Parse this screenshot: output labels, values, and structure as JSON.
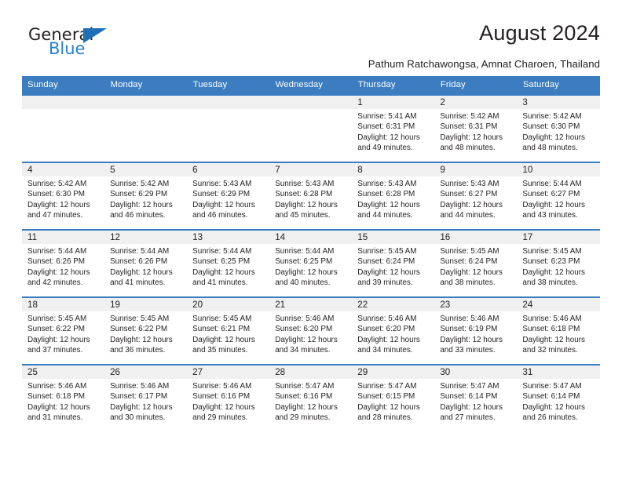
{
  "brand": {
    "name_top": "General",
    "name_bottom": "Blue",
    "accent_color": "#2980d0",
    "triangle_color": "#1e6fb8"
  },
  "header": {
    "title": "August 2024",
    "subtitle": "Pathum Ratchawongsa, Amnat Charoen, Thailand",
    "header_bg": "#3b7dc0",
    "header_text": "#ffffff"
  },
  "weekdays": [
    "Sunday",
    "Monday",
    "Tuesday",
    "Wednesday",
    "Thursday",
    "Friday",
    "Saturday"
  ],
  "labels": {
    "sunrise_prefix": "Sunrise:",
    "sunset_prefix": "Sunset:",
    "daylight_prefix": "Daylight:"
  },
  "weeks": [
    [
      {
        "day": "",
        "empty": true
      },
      {
        "day": "",
        "empty": true
      },
      {
        "day": "",
        "empty": true
      },
      {
        "day": "",
        "empty": true
      },
      {
        "day": "1",
        "sunrise": "Sunrise: 5:41 AM",
        "sunset": "Sunset: 6:31 PM",
        "daylight": "Daylight: 12 hours and 49 minutes."
      },
      {
        "day": "2",
        "sunrise": "Sunrise: 5:42 AM",
        "sunset": "Sunset: 6:31 PM",
        "daylight": "Daylight: 12 hours and 48 minutes."
      },
      {
        "day": "3",
        "sunrise": "Sunrise: 5:42 AM",
        "sunset": "Sunset: 6:30 PM",
        "daylight": "Daylight: 12 hours and 48 minutes."
      }
    ],
    [
      {
        "day": "4",
        "sunrise": "Sunrise: 5:42 AM",
        "sunset": "Sunset: 6:30 PM",
        "daylight": "Daylight: 12 hours and 47 minutes."
      },
      {
        "day": "5",
        "sunrise": "Sunrise: 5:42 AM",
        "sunset": "Sunset: 6:29 PM",
        "daylight": "Daylight: 12 hours and 46 minutes."
      },
      {
        "day": "6",
        "sunrise": "Sunrise: 5:43 AM",
        "sunset": "Sunset: 6:29 PM",
        "daylight": "Daylight: 12 hours and 46 minutes."
      },
      {
        "day": "7",
        "sunrise": "Sunrise: 5:43 AM",
        "sunset": "Sunset: 6:28 PM",
        "daylight": "Daylight: 12 hours and 45 minutes."
      },
      {
        "day": "8",
        "sunrise": "Sunrise: 5:43 AM",
        "sunset": "Sunset: 6:28 PM",
        "daylight": "Daylight: 12 hours and 44 minutes."
      },
      {
        "day": "9",
        "sunrise": "Sunrise: 5:43 AM",
        "sunset": "Sunset: 6:27 PM",
        "daylight": "Daylight: 12 hours and 44 minutes."
      },
      {
        "day": "10",
        "sunrise": "Sunrise: 5:44 AM",
        "sunset": "Sunset: 6:27 PM",
        "daylight": "Daylight: 12 hours and 43 minutes."
      }
    ],
    [
      {
        "day": "11",
        "sunrise": "Sunrise: 5:44 AM",
        "sunset": "Sunset: 6:26 PM",
        "daylight": "Daylight: 12 hours and 42 minutes."
      },
      {
        "day": "12",
        "sunrise": "Sunrise: 5:44 AM",
        "sunset": "Sunset: 6:26 PM",
        "daylight": "Daylight: 12 hours and 41 minutes."
      },
      {
        "day": "13",
        "sunrise": "Sunrise: 5:44 AM",
        "sunset": "Sunset: 6:25 PM",
        "daylight": "Daylight: 12 hours and 41 minutes."
      },
      {
        "day": "14",
        "sunrise": "Sunrise: 5:44 AM",
        "sunset": "Sunset: 6:25 PM",
        "daylight": "Daylight: 12 hours and 40 minutes."
      },
      {
        "day": "15",
        "sunrise": "Sunrise: 5:45 AM",
        "sunset": "Sunset: 6:24 PM",
        "daylight": "Daylight: 12 hours and 39 minutes."
      },
      {
        "day": "16",
        "sunrise": "Sunrise: 5:45 AM",
        "sunset": "Sunset: 6:24 PM",
        "daylight": "Daylight: 12 hours and 38 minutes."
      },
      {
        "day": "17",
        "sunrise": "Sunrise: 5:45 AM",
        "sunset": "Sunset: 6:23 PM",
        "daylight": "Daylight: 12 hours and 38 minutes."
      }
    ],
    [
      {
        "day": "18",
        "sunrise": "Sunrise: 5:45 AM",
        "sunset": "Sunset: 6:22 PM",
        "daylight": "Daylight: 12 hours and 37 minutes."
      },
      {
        "day": "19",
        "sunrise": "Sunrise: 5:45 AM",
        "sunset": "Sunset: 6:22 PM",
        "daylight": "Daylight: 12 hours and 36 minutes."
      },
      {
        "day": "20",
        "sunrise": "Sunrise: 5:45 AM",
        "sunset": "Sunset: 6:21 PM",
        "daylight": "Daylight: 12 hours and 35 minutes."
      },
      {
        "day": "21",
        "sunrise": "Sunrise: 5:46 AM",
        "sunset": "Sunset: 6:20 PM",
        "daylight": "Daylight: 12 hours and 34 minutes."
      },
      {
        "day": "22",
        "sunrise": "Sunrise: 5:46 AM",
        "sunset": "Sunset: 6:20 PM",
        "daylight": "Daylight: 12 hours and 34 minutes."
      },
      {
        "day": "23",
        "sunrise": "Sunrise: 5:46 AM",
        "sunset": "Sunset: 6:19 PM",
        "daylight": "Daylight: 12 hours and 33 minutes."
      },
      {
        "day": "24",
        "sunrise": "Sunrise: 5:46 AM",
        "sunset": "Sunset: 6:18 PM",
        "daylight": "Daylight: 12 hours and 32 minutes."
      }
    ],
    [
      {
        "day": "25",
        "sunrise": "Sunrise: 5:46 AM",
        "sunset": "Sunset: 6:18 PM",
        "daylight": "Daylight: 12 hours and 31 minutes."
      },
      {
        "day": "26",
        "sunrise": "Sunrise: 5:46 AM",
        "sunset": "Sunset: 6:17 PM",
        "daylight": "Daylight: 12 hours and 30 minutes."
      },
      {
        "day": "27",
        "sunrise": "Sunrise: 5:46 AM",
        "sunset": "Sunset: 6:16 PM",
        "daylight": "Daylight: 12 hours and 29 minutes."
      },
      {
        "day": "28",
        "sunrise": "Sunrise: 5:47 AM",
        "sunset": "Sunset: 6:16 PM",
        "daylight": "Daylight: 12 hours and 29 minutes."
      },
      {
        "day": "29",
        "sunrise": "Sunrise: 5:47 AM",
        "sunset": "Sunset: 6:15 PM",
        "daylight": "Daylight: 12 hours and 28 minutes."
      },
      {
        "day": "30",
        "sunrise": "Sunrise: 5:47 AM",
        "sunset": "Sunset: 6:14 PM",
        "daylight": "Daylight: 12 hours and 27 minutes."
      },
      {
        "day": "31",
        "sunrise": "Sunrise: 5:47 AM",
        "sunset": "Sunset: 6:14 PM",
        "daylight": "Daylight: 12 hours and 26 minutes."
      }
    ]
  ]
}
